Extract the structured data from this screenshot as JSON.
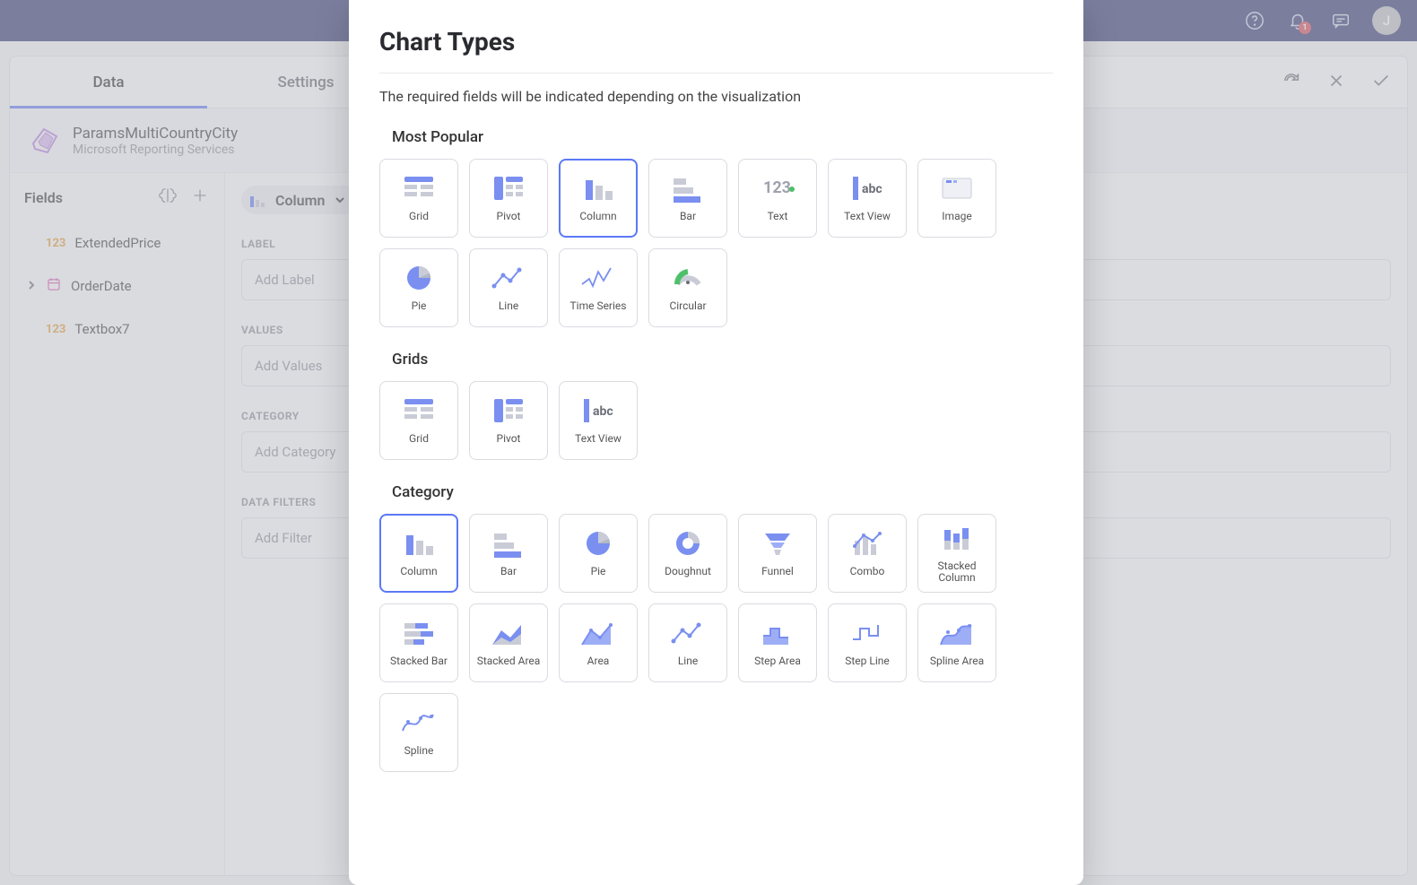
{
  "header": {
    "notification_count": "1",
    "avatar_initial": "J"
  },
  "tabs": {
    "data": "Data",
    "settings": "Settings"
  },
  "actions": {
    "redo": "Redo",
    "close": "Close",
    "confirm": "Confirm"
  },
  "datasource": {
    "name": "ParamsMultiCountryCity",
    "provider": "Microsoft Reporting Services"
  },
  "fields": {
    "title": "Fields",
    "items": [
      {
        "type": "number",
        "name": "ExtendedPrice"
      },
      {
        "type": "date",
        "name": "OrderDate"
      },
      {
        "type": "number",
        "name": "Textbox7"
      }
    ]
  },
  "chart_selector": {
    "current": "Column"
  },
  "config": {
    "label_section": "LABEL",
    "label_placeholder": "Add Label",
    "values_section": "VALUES",
    "values_placeholder": "Add Values",
    "category_section": "CATEGORY",
    "category_placeholder": "Add Category",
    "filters_section": "DATA FILTERS",
    "filters_placeholder": "Add Filter"
  },
  "modal": {
    "title": "Chart Types",
    "hint": "The required fields will be indicated depending on the visualization",
    "sections": [
      {
        "name": "Most Popular",
        "tiles": [
          "Grid",
          "Pivot",
          "Column",
          "Bar",
          "Text",
          "Text View",
          "Image",
          "Pie",
          "Line",
          "Time Series",
          "Circular"
        ],
        "selected": "Column"
      },
      {
        "name": "Grids",
        "tiles": [
          "Grid",
          "Pivot",
          "Text View"
        ]
      },
      {
        "name": "Category",
        "tiles": [
          "Column",
          "Bar",
          "Pie",
          "Doughnut",
          "Funnel",
          "Combo",
          "Stacked Column",
          "Stacked Bar",
          "Stacked Area",
          "Area",
          "Line",
          "Step Area",
          "Step Line",
          "Spline Area",
          "Spline"
        ],
        "selected": "Column"
      }
    ]
  }
}
